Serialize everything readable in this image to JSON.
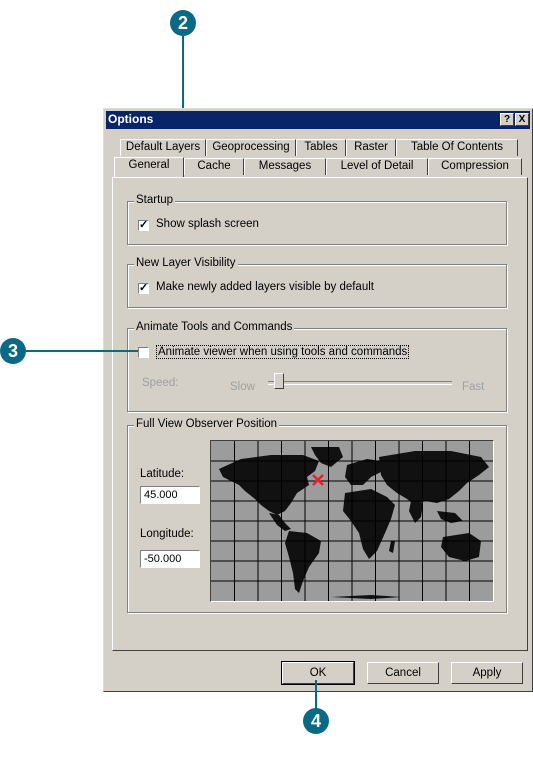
{
  "callouts": {
    "c2": "2",
    "c3": "3",
    "c4": "4"
  },
  "window": {
    "title": "Options",
    "help_btn": "?",
    "close_btn": "X"
  },
  "tabs_back": [
    "Default Layers",
    "Geoprocessing",
    "Tables",
    "Raster",
    "Table Of Contents"
  ],
  "tabs_front": [
    "General",
    "Cache",
    "Messages",
    "Level of Detail",
    "Compression"
  ],
  "active_tab": "General",
  "startup": {
    "label": "Startup",
    "checkbox": "Show splash screen",
    "checked": true
  },
  "visibility": {
    "label": "New Layer Visibility",
    "checkbox": "Make newly added layers visible by default",
    "checked": true
  },
  "animate": {
    "label": "Animate Tools and Commands",
    "checkbox": "Animate viewer when using tools and commands",
    "checked": false,
    "speed_label": "Speed:",
    "slow": "Slow",
    "fast": "Fast"
  },
  "observer": {
    "label": "Full View Observer Position",
    "latitude_label": "Latitude:",
    "latitude": "45.000",
    "longitude_label": "Longitude:",
    "longitude": "-50.000"
  },
  "buttons": {
    "ok": "OK",
    "cancel": "Cancel",
    "apply": "Apply"
  },
  "colors": {
    "callout": "#0a6a86",
    "titlebar": "#0a246a",
    "marker": "#e8202a"
  }
}
